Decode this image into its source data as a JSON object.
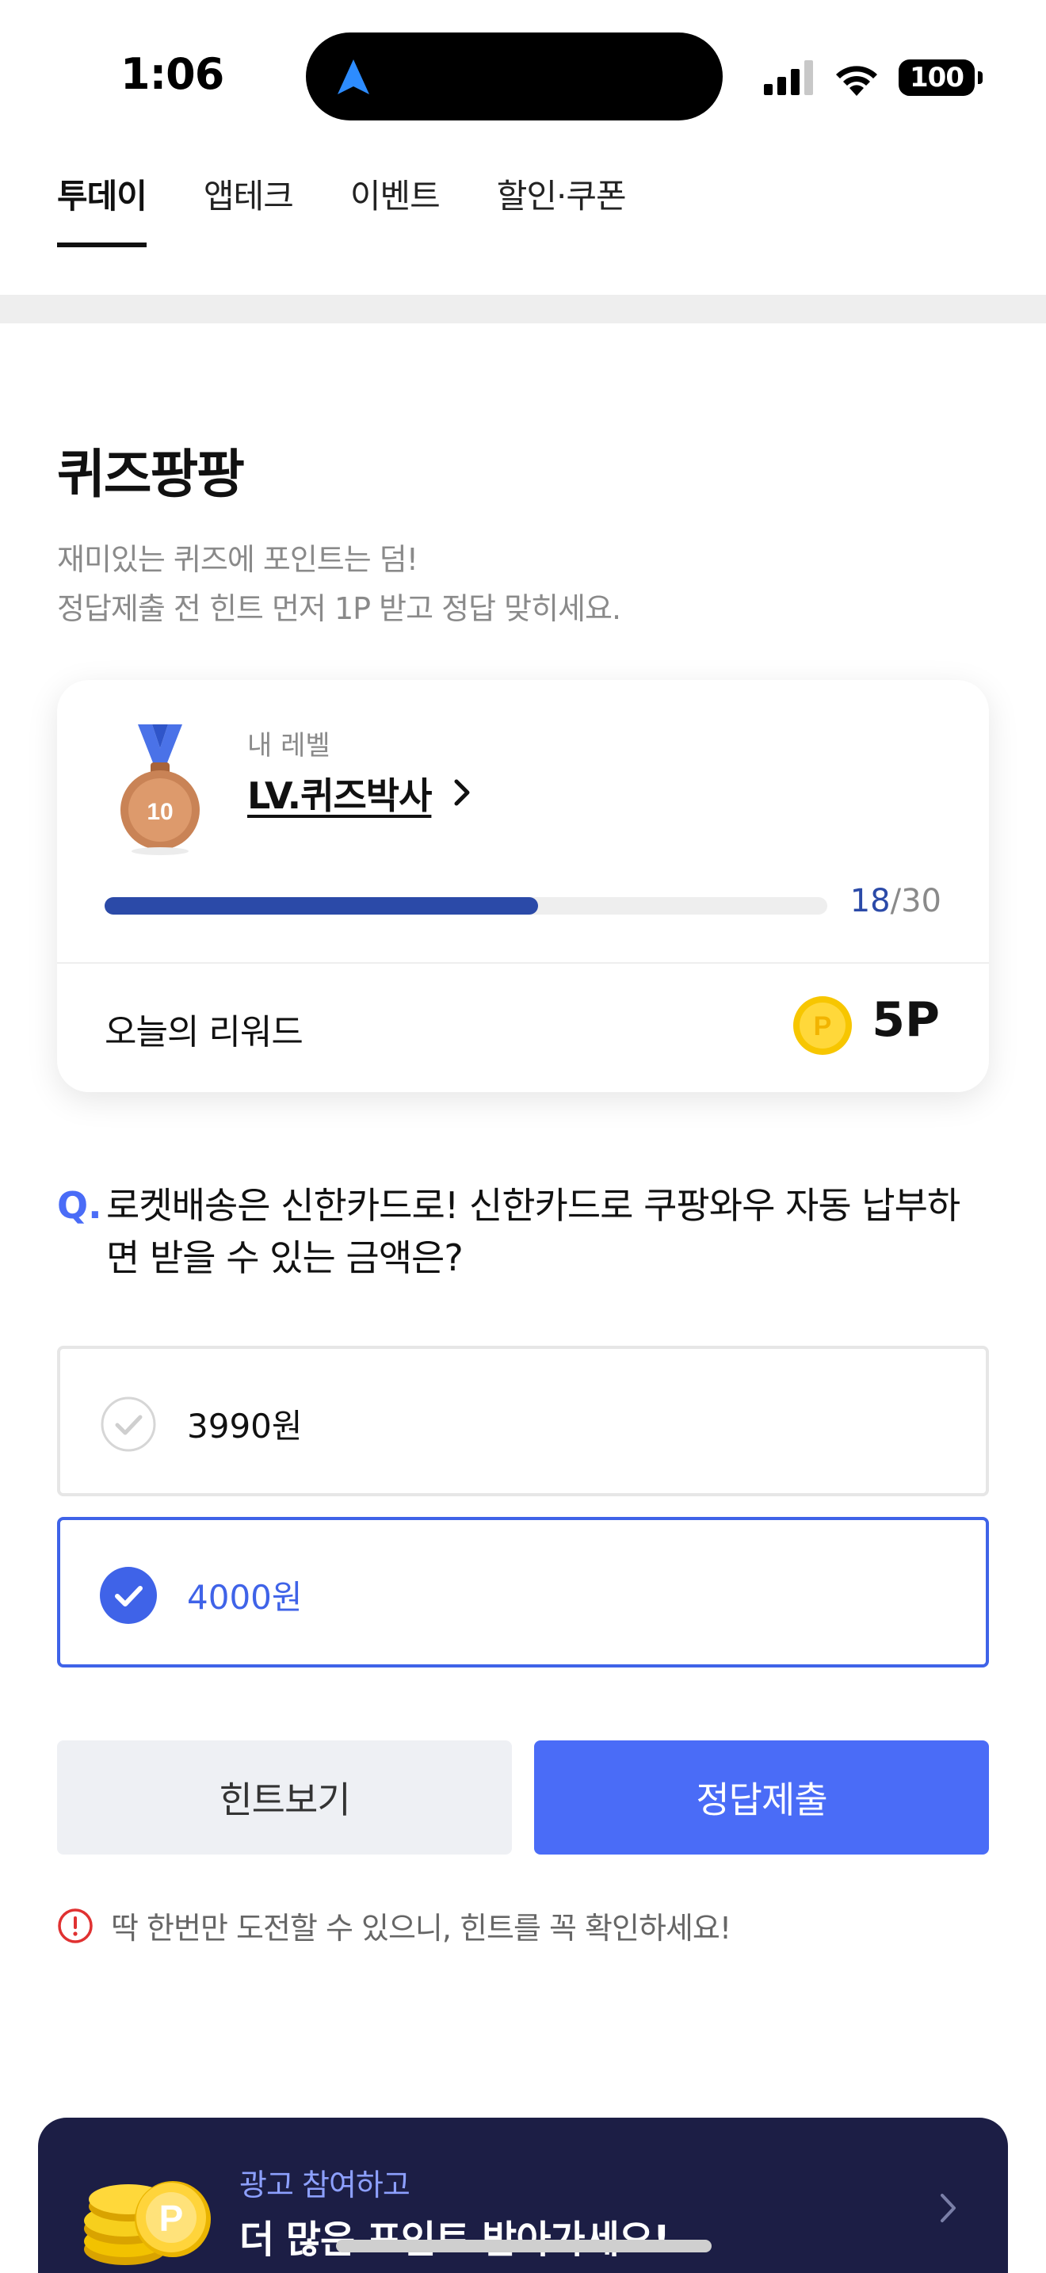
{
  "status_bar": {
    "time": "1:06",
    "battery": "100"
  },
  "tabs": [
    {
      "label": "투데이",
      "active": true
    },
    {
      "label": "앱테크",
      "active": false
    },
    {
      "label": "이벤트",
      "active": false
    },
    {
      "label": "할인·쿠폰",
      "active": false
    }
  ],
  "header": {
    "title": "퀴즈팡팡",
    "subtitle_line1": "재미있는 퀴즈에 포인트는 덤!",
    "subtitle_line2": "정답제출 전 힌트 먼저 1P 받고 정답 맞히세요."
  },
  "level_card": {
    "medal_number": "10",
    "label": "내 레벨",
    "level_name": "LV.퀴즈박사",
    "progress_current": "18",
    "progress_total": "/30",
    "progress_fraction": 0.6,
    "reward_label": "오늘의 리워드",
    "reward_value": "5P"
  },
  "question": {
    "mark": "Q.",
    "text": "로켓배송은 신한카드로! 신한카드로 쿠팡와우 자동 납부하면 받을 수 있는 금액은?"
  },
  "options": [
    {
      "label": "3990원",
      "selected": false
    },
    {
      "label": "4000원",
      "selected": true
    }
  ],
  "buttons": {
    "hint": "힌트보기",
    "submit": "정답제출"
  },
  "warning": "딱 한번만 도전할 수 있으니, 힌트를 꼭 확인하세요!",
  "ad_banner": {
    "line1": "광고 참여하고",
    "line2": "더 많은 포인트 받아가세요!"
  },
  "colors": {
    "accent": "#4a6cf7",
    "progress": "#2b4aa8",
    "ad_background": "#1c1e45",
    "warning": "#e03131"
  }
}
